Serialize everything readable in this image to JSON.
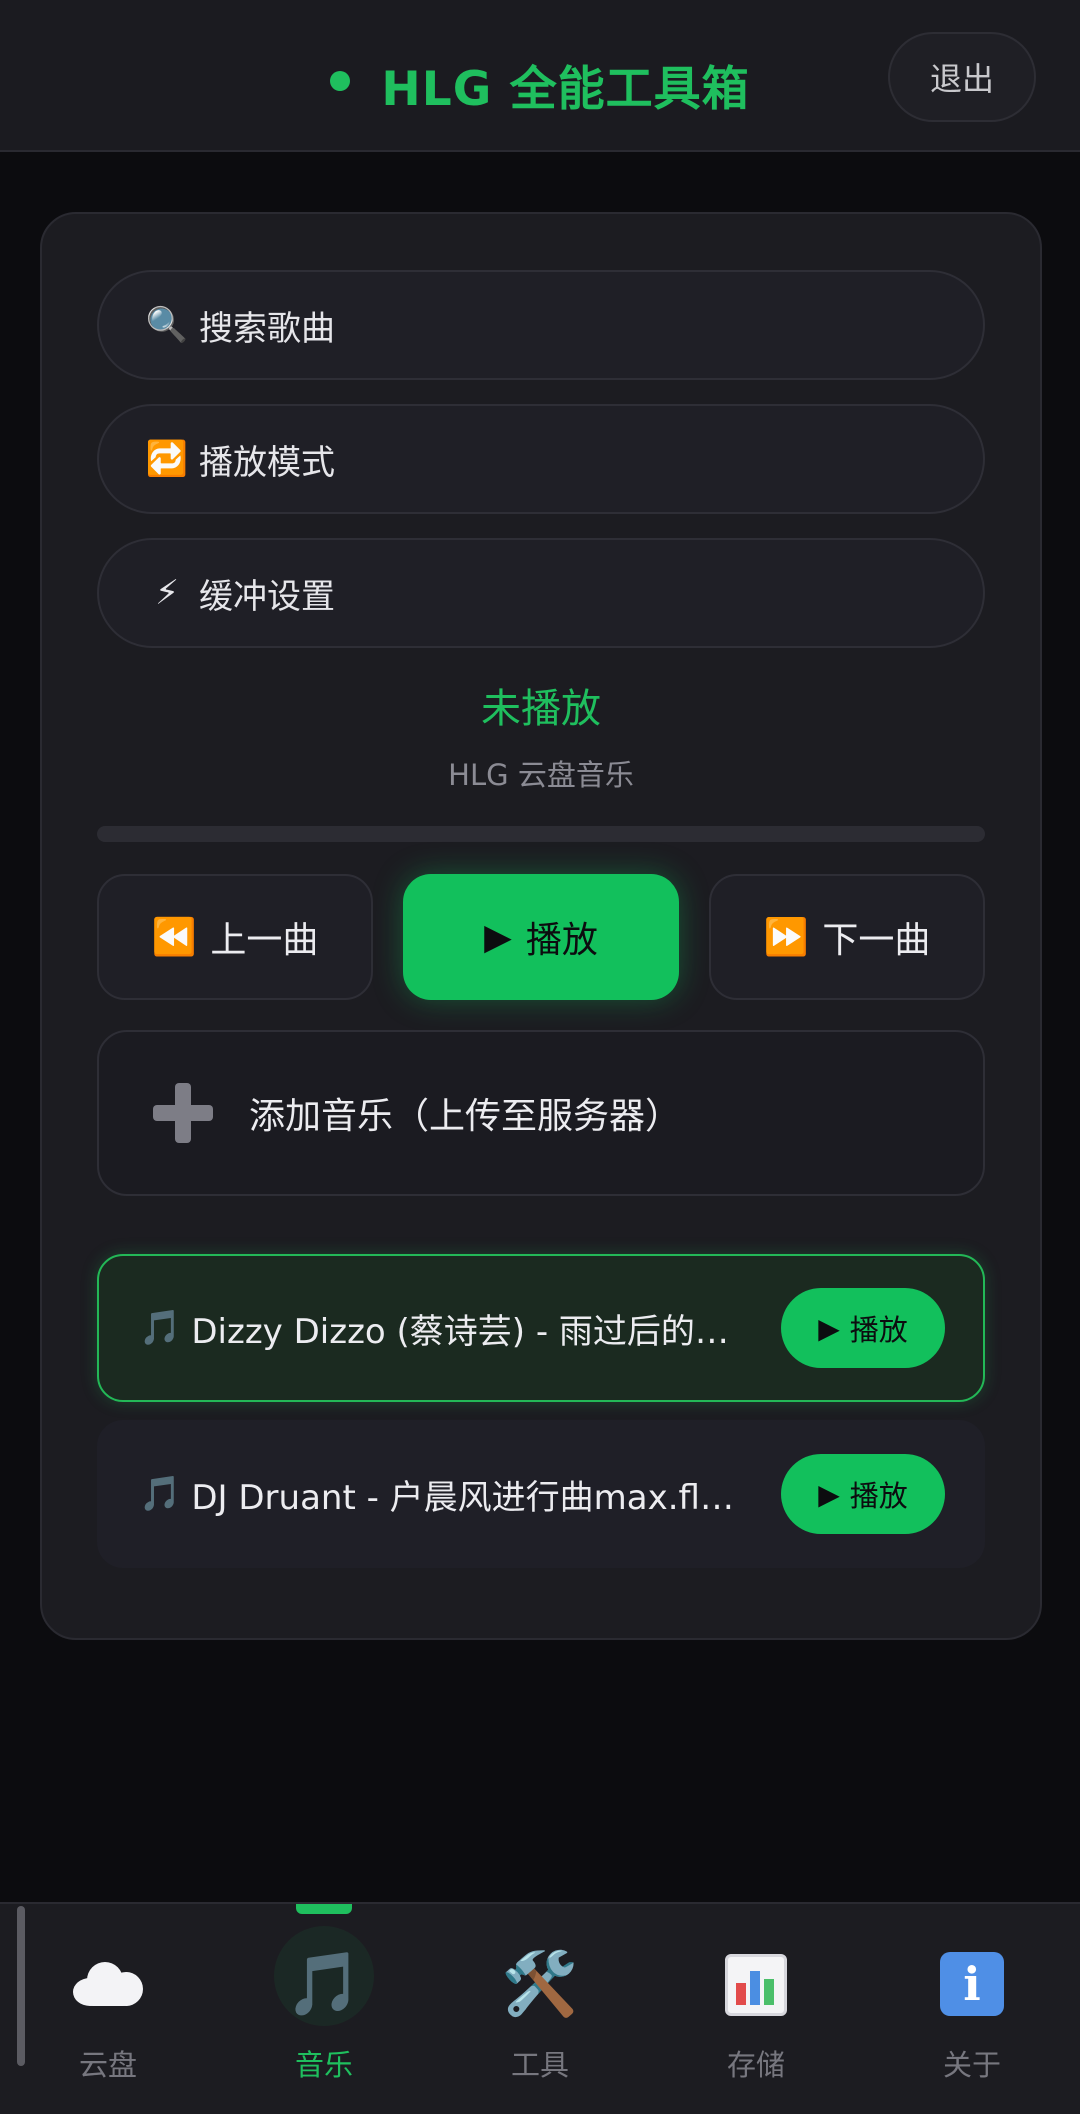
{
  "header": {
    "title": "HLG 全能工具箱",
    "logout_label": "退出",
    "accent": "#1fbf5e"
  },
  "menu": {
    "search": {
      "icon": "🔍",
      "label": "搜索歌曲"
    },
    "mode": {
      "icon": "🔁",
      "label": "播放模式"
    },
    "buffer": {
      "icon": "⚡",
      "label": "缓冲设置"
    }
  },
  "player": {
    "status": "未播放",
    "subtitle": "HLG 云盘音乐",
    "progress": 0,
    "prev_icon": "⏪",
    "prev_label": "上一曲",
    "play_icon": "▶",
    "play_label": "播放",
    "next_icon": "⏩",
    "next_label": "下一曲"
  },
  "add_music": {
    "icon": "plus-icon",
    "label": "添加音乐（上传至服务器）"
  },
  "tracks": [
    {
      "note": "🎵",
      "name": "Dizzy Dizzo (蔡诗芸) - 雨过后的…",
      "play_label": "播放",
      "play_icon": "▶",
      "active": true
    },
    {
      "note": "🎵",
      "name": "DJ Druant - 户晨风进行曲max.fl…",
      "play_label": "播放",
      "play_icon": "▶",
      "active": false
    }
  ],
  "bottom_nav": [
    {
      "icon": "cloud-icon",
      "label": "云盘"
    },
    {
      "icon": "🎵",
      "label": "音乐",
      "active": true
    },
    {
      "icon": "🛠️",
      "label": "工具"
    },
    {
      "icon": "bar-chart-icon",
      "label": "存储"
    },
    {
      "icon": "info-icon",
      "label": "关于"
    }
  ]
}
